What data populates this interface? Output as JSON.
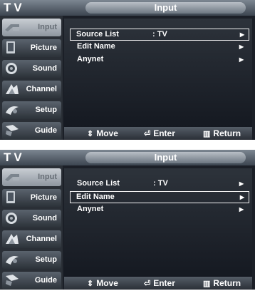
{
  "screens": [
    {
      "tv_label": "TV",
      "title": "Input",
      "sidebar": [
        {
          "label": "Input",
          "icon": "input-icon",
          "active": true
        },
        {
          "label": "Picture",
          "icon": "picture-icon",
          "active": false
        },
        {
          "label": "Sound",
          "icon": "sound-icon",
          "active": false
        },
        {
          "label": "Channel",
          "icon": "channel-icon",
          "active": false
        },
        {
          "label": "Setup",
          "icon": "setup-icon",
          "active": false
        },
        {
          "label": "Guide",
          "icon": "guide-icon",
          "active": false
        }
      ],
      "rows": [
        {
          "name": "Source List",
          "value": ": TV",
          "arrow": "▶",
          "selected": true
        },
        {
          "name": "Edit Name",
          "value": "",
          "arrow": "▶",
          "selected": false
        },
        {
          "name": "Anynet",
          "value": "",
          "arrow": "▶",
          "selected": false
        }
      ],
      "footer": {
        "move": "Move",
        "enter": "Enter",
        "return": "Return"
      }
    },
    {
      "tv_label": "TV",
      "title": "Input",
      "sidebar": [
        {
          "label": "Input",
          "icon": "input-icon",
          "active": true
        },
        {
          "label": "Picture",
          "icon": "picture-icon",
          "active": false
        },
        {
          "label": "Sound",
          "icon": "sound-icon",
          "active": false
        },
        {
          "label": "Channel",
          "icon": "channel-icon",
          "active": false
        },
        {
          "label": "Setup",
          "icon": "setup-icon",
          "active": false
        },
        {
          "label": "Guide",
          "icon": "guide-icon",
          "active": false
        }
      ],
      "rows": [
        {
          "name": "Source List",
          "value": ": TV",
          "arrow": "▶",
          "selected": false
        },
        {
          "name": "Edit Name",
          "value": "",
          "arrow": "▶",
          "selected": true
        },
        {
          "name": "Anynet",
          "value": "",
          "arrow": "▶",
          "selected": false
        }
      ],
      "footer": {
        "move": "Move",
        "enter": "Enter",
        "return": "Return"
      }
    }
  ]
}
